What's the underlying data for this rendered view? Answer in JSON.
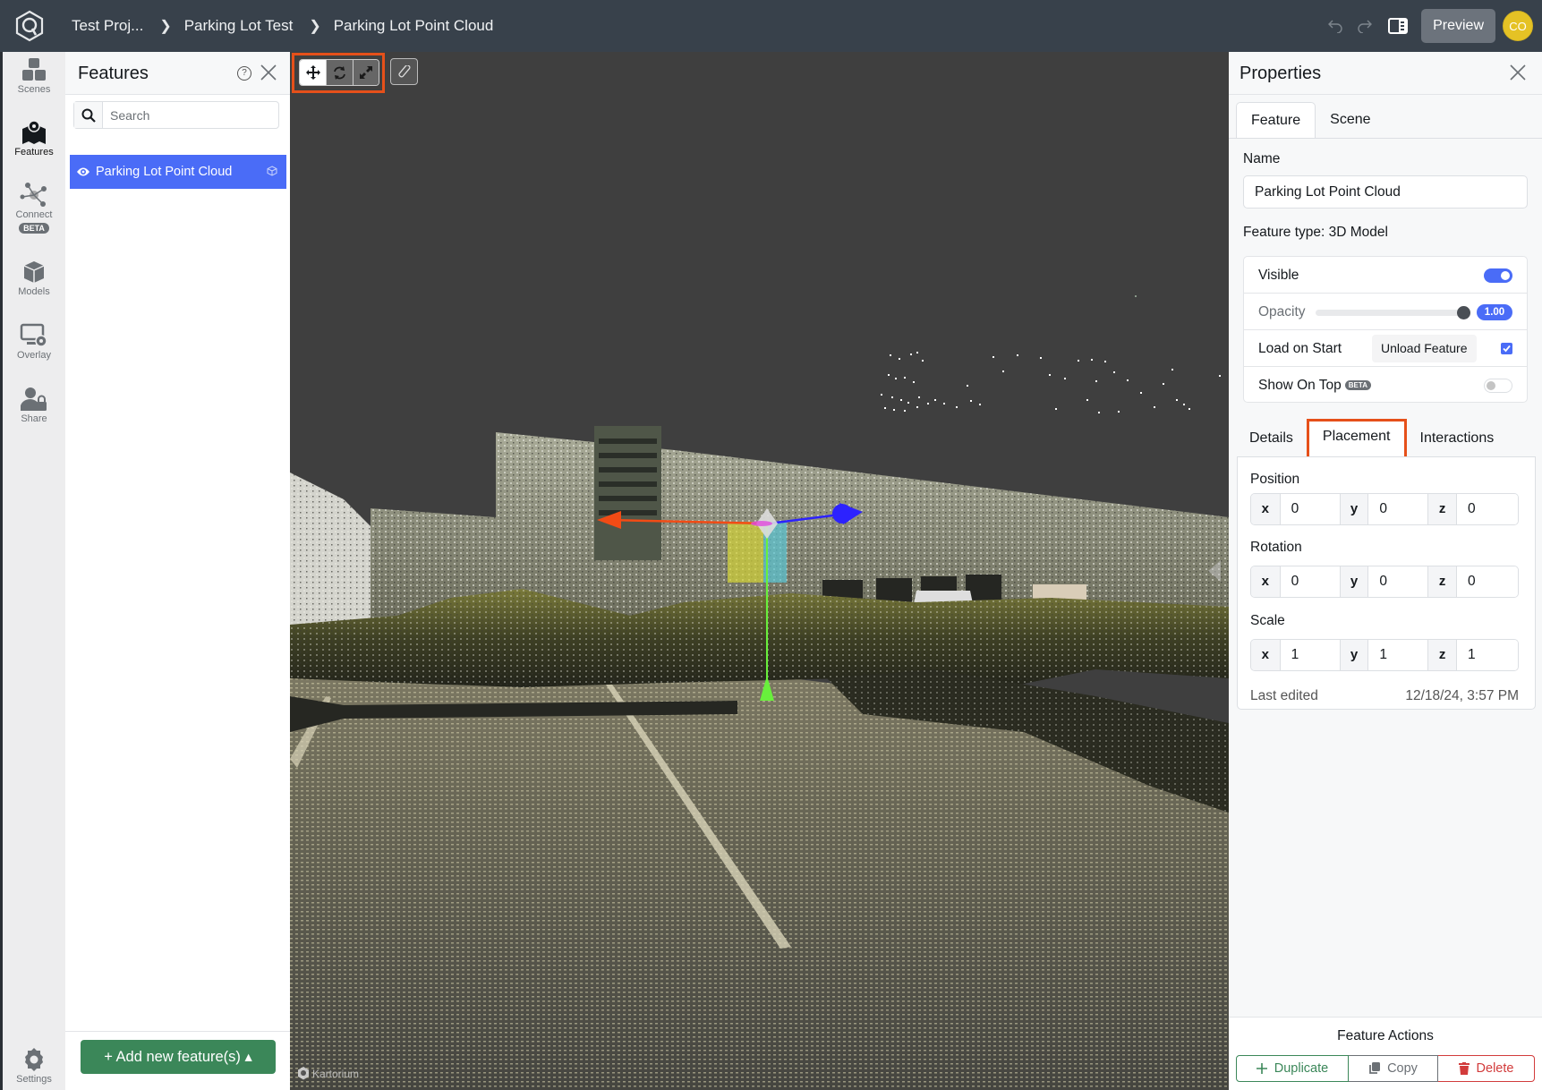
{
  "app": {
    "breadcrumbs": [
      "Test Proj...",
      "Parking Lot Test",
      "Parking Lot Point Cloud"
    ],
    "preview_label": "Preview",
    "avatar_initials": "CO",
    "accent_color": "#4a6cf7",
    "highlight_color": "#e6501a"
  },
  "nav": {
    "items": [
      {
        "label": "Scenes"
      },
      {
        "label": "Features"
      },
      {
        "label": "Connect",
        "badge": "BETA"
      },
      {
        "label": "Models"
      },
      {
        "label": "Overlay"
      },
      {
        "label": "Share"
      },
      {
        "label": "Settings"
      }
    ]
  },
  "features_panel": {
    "title": "Features",
    "help_glyph": "?",
    "search_placeholder": "Search",
    "items": [
      {
        "label": "Parking Lot Point Cloud",
        "visible": true,
        "selected": true
      }
    ],
    "add_label": "+ Add new feature(s) ▴"
  },
  "viewport": {
    "tools": [
      "move",
      "rotate",
      "scale"
    ],
    "active_tool": "move",
    "watermark": "Kartorium"
  },
  "properties": {
    "title": "Properties",
    "tabs": [
      "Feature",
      "Scene"
    ],
    "active_tab": "Feature",
    "name_label": "Name",
    "name_value": "Parking Lot Point Cloud",
    "feature_type": "Feature type: 3D Model",
    "visible_label": "Visible",
    "visible": true,
    "opacity_label": "Opacity",
    "opacity": 1.0,
    "opacity_text": "1.00",
    "load_on_start_label": "Load on Start",
    "unload_label": "Unload Feature",
    "load_on_start": true,
    "show_on_top_label": "Show On Top",
    "show_on_top_badge": "BETA",
    "show_on_top": false,
    "sub_tabs": [
      "Details",
      "Placement",
      "Interactions"
    ],
    "active_sub_tab": "Placement",
    "position_label": "Position",
    "position": {
      "x": "0",
      "y": "0",
      "z": "0"
    },
    "rotation_label": "Rotation",
    "rotation": {
      "x": "0",
      "y": "0",
      "z": "0"
    },
    "scale_label": "Scale",
    "scale": {
      "x": "1",
      "y": "1",
      "z": "1"
    },
    "axis_labels": {
      "x": "x",
      "y": "y",
      "z": "z"
    },
    "last_edited_label": "Last edited",
    "last_edited_value": "12/18/24, 3:57 PM",
    "actions_title": "Feature Actions",
    "duplicate_label": "Duplicate",
    "copy_label": "Copy",
    "delete_label": "Delete"
  }
}
